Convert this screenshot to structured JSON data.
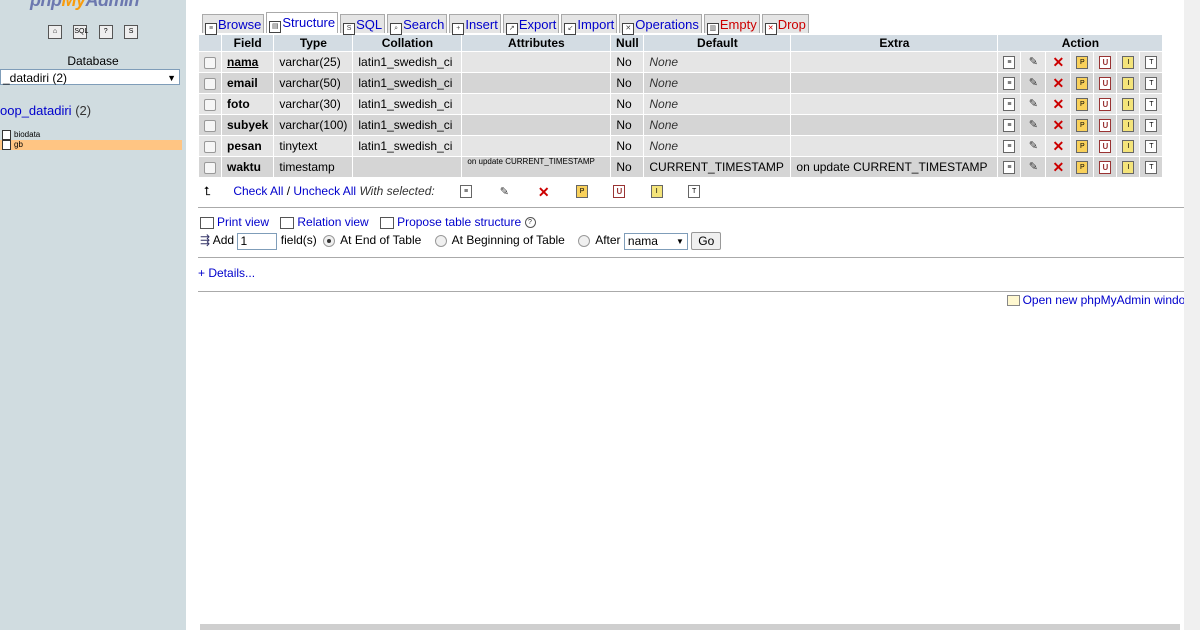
{
  "sidebar": {
    "logo_left": "php",
    "logo_mid": "My",
    "logo_right": "Admin",
    "database_label": "Database",
    "database_select": "_datadiri (2)",
    "db_name": "oop_datadiri",
    "db_count": "(2)",
    "tables": [
      "biodata",
      "gb"
    ]
  },
  "tabs": [
    {
      "label": "Browse"
    },
    {
      "label": "Structure"
    },
    {
      "label": "SQL"
    },
    {
      "label": "Search"
    },
    {
      "label": "Insert"
    },
    {
      "label": "Export"
    },
    {
      "label": "Import"
    },
    {
      "label": "Operations"
    },
    {
      "label": "Empty"
    },
    {
      "label": "Drop"
    }
  ],
  "table": {
    "headers": {
      "field": "Field",
      "type": "Type",
      "collation": "Collation",
      "attributes": "Attributes",
      "null": "Null",
      "default": "Default",
      "extra": "Extra",
      "action": "Action"
    },
    "rows": [
      {
        "field": "nama",
        "type": "varchar(25)",
        "collation": "latin1_swedish_ci",
        "attributes": "",
        "null": "No",
        "default": "None",
        "extra": ""
      },
      {
        "field": "email",
        "type": "varchar(50)",
        "collation": "latin1_swedish_ci",
        "attributes": "",
        "null": "No",
        "default": "None",
        "extra": ""
      },
      {
        "field": "foto",
        "type": "varchar(30)",
        "collation": "latin1_swedish_ci",
        "attributes": "",
        "null": "No",
        "default": "None",
        "extra": ""
      },
      {
        "field": "subyek",
        "type": "varchar(100)",
        "collation": "latin1_swedish_ci",
        "attributes": "",
        "null": "No",
        "default": "None",
        "extra": ""
      },
      {
        "field": "pesan",
        "type": "tinytext",
        "collation": "latin1_swedish_ci",
        "attributes": "",
        "null": "No",
        "default": "None",
        "extra": ""
      },
      {
        "field": "waktu",
        "type": "timestamp",
        "collation": "",
        "attributes": "on update CURRENT_TIMESTAMP",
        "null": "No",
        "default": "CURRENT_TIMESTAMP",
        "extra": "on update CURRENT_TIMESTAMP"
      }
    ]
  },
  "with_selected": {
    "check_all": "Check All",
    "separator": " / ",
    "uncheck_all": "Uncheck All",
    "label": "With selected:"
  },
  "links": {
    "print_view": "Print view",
    "relation_view": "Relation view",
    "propose": "Propose table structure"
  },
  "add_fields": {
    "add": "Add",
    "count": "1",
    "fields": "field(s)",
    "end": "At End of Table",
    "beginning": "At Beginning of Table",
    "after": "After",
    "after_value": "nama",
    "go": "Go"
  },
  "details": "+ Details...",
  "open_new_window": "Open new phpMyAdmin window"
}
